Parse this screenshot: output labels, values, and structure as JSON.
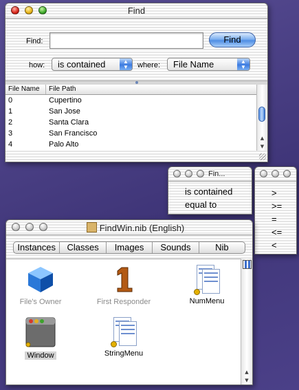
{
  "find_window": {
    "title": "Find",
    "find_label": "Find:",
    "find_value": "",
    "find_button": "Find",
    "how_label": "how:",
    "how_value": "is contained",
    "where_label": "where:",
    "where_value": "File Name",
    "columns": [
      "File Name",
      "File Path"
    ],
    "rows": [
      {
        "name": "0",
        "path": "Cupertino"
      },
      {
        "name": "1",
        "path": "San Jose"
      },
      {
        "name": "2",
        "path": "Santa Clara"
      },
      {
        "name": "3",
        "path": "San Francisco"
      },
      {
        "name": "4",
        "path": "Palo Alto"
      }
    ]
  },
  "string_panel": {
    "title": "Fin...",
    "items": [
      "is contained",
      "equal to"
    ]
  },
  "operator_panel": {
    "items": [
      ">",
      ">=",
      "=",
      "<=",
      "<"
    ]
  },
  "nib_window": {
    "title": "FindWin.nib (English)",
    "tabs": [
      "Instances",
      "Classes",
      "Images",
      "Sounds",
      "Nib"
    ],
    "objects": [
      {
        "label": "File's Owner",
        "icon": "cube-icon"
      },
      {
        "label": "First Responder",
        "icon": "number-one-icon"
      },
      {
        "label": "NumMenu",
        "icon": "menu-document-icon"
      },
      {
        "label": "Window",
        "icon": "window-icon"
      },
      {
        "label": "StringMenu",
        "icon": "menu-document-icon"
      }
    ]
  }
}
